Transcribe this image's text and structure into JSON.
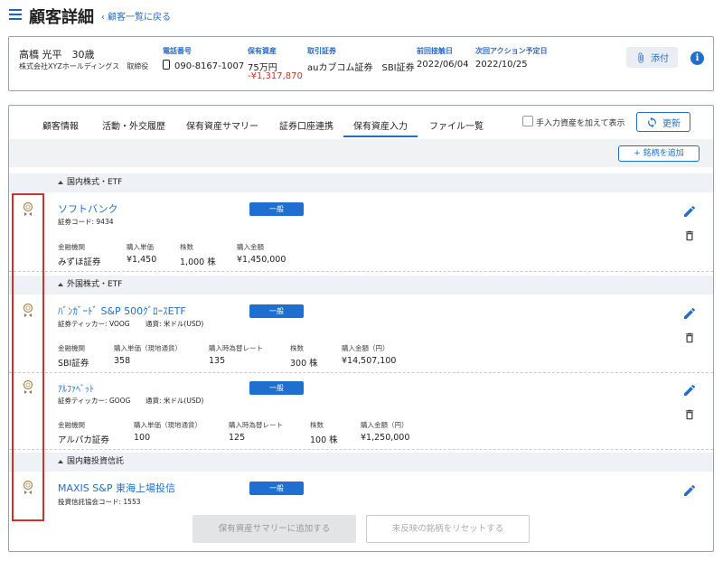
{
  "header": {
    "title": "顧客詳細",
    "back_link": "顧客一覧に戻る"
  },
  "customer": {
    "name": "高橋 光平",
    "age": "30歳",
    "company": "株式会社XYZホールディングス",
    "role": "取締役",
    "phone_label": "電話番号",
    "phone": "090-8167-1007",
    "assets_label": "保有資産",
    "assets": "75万円",
    "assets_change": "-¥1,317,870",
    "broker_label": "取引証券",
    "brokers": "auカブコム証券　SBI証券",
    "last_contact_label": "前回接触日",
    "last_contact": "2022/06/04",
    "next_action_label": "次回アクション予定日",
    "next_action": "2022/10/25",
    "attach_label": "添付"
  },
  "tabs": [
    "顧客情報",
    "活動・外交履歴",
    "保有資産サマリー",
    "証券口座連携",
    "保有資産入力",
    "ファイル一覧"
  ],
  "active_tab": "保有資産入力",
  "toolbar": {
    "include_manual": "手入力資産を加えて表示",
    "refresh": "更新",
    "add_stock": "+ 銘柄を追加"
  },
  "sections": {
    "domestic": "国内株式・ETF",
    "foreign": "外国株式・ETF",
    "fund": "国内籍投資信託"
  },
  "items": {
    "softbank": {
      "name": "ソフトバンク",
      "code": "証券コード: 9434",
      "badge": "一般",
      "labels": [
        "金融機関",
        "購入単価",
        "株数",
        "購入金額"
      ],
      "values": [
        "みずほ証券",
        "¥1,450",
        "1,000 株",
        "¥1,450,000"
      ]
    },
    "vanguard": {
      "name": "ﾊﾞﾝｶﾞｰﾄﾞ S&P 500ｸﾞﾛｰｽETF",
      "ticker": "証券ティッカー: VOOG",
      "currency": "通貨: 米ドル(USD)",
      "badge": "一般",
      "labels": [
        "金融機関",
        "購入単価（現地通貨）",
        "購入時為替レート",
        "株数",
        "購入金額（円）"
      ],
      "values": [
        "SBI証券",
        "358",
        "135",
        "300 株",
        "¥14,507,100"
      ]
    },
    "alphabet": {
      "name": "ｱﾙﾌｧﾍﾞｯﾄ",
      "ticker": "証券ティッカー: GOOG",
      "currency": "通貨: 米ドル(USD)",
      "badge": "一般",
      "labels": [
        "金融機関",
        "購入単価（現地通貨）",
        "購入時為替レート",
        "株数",
        "購入金額（円）"
      ],
      "values": [
        "アルパカ証券",
        "100",
        "125",
        "100 株",
        "¥1,250,000"
      ]
    },
    "maxis": {
      "name": "MAXIS S&P 東海上場投信",
      "code": "投資信託協会コード: 1553",
      "badge": "一般"
    }
  },
  "footer": {
    "add_summary": "保有資産サマリーに追加する",
    "reset": "未反映の銘柄をリセットする"
  },
  "colors": {
    "accent": "#1f6fd1",
    "negative": "#c0392b",
    "highlight_box": "#d0312d"
  }
}
